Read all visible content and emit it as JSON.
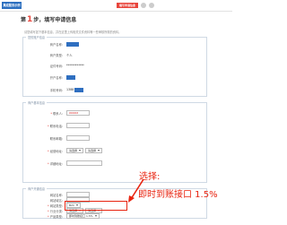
{
  "topbar": {
    "logo": "集成服务示例",
    "steps": [
      "填写申请信息",
      "",
      ""
    ],
    "active_step": 0
  },
  "header": {
    "step_prefix": "第",
    "step_number": "1",
    "title": "步，填写申请信息"
  },
  "intro": "请您填写如下基本信息，并在这里上传相关文件资料等一些审核所需的资料。",
  "section1": {
    "title": "您的账户信息",
    "rows": [
      {
        "label": "商户名称:",
        "value": ""
      },
      {
        "label": "商户类型:",
        "value": "个人"
      },
      {
        "label": "证件号码:",
        "value": "************"
      },
      {
        "label": "开户名称:",
        "value": ""
      },
      {
        "label": "手机号码:",
        "value": "1388"
      }
    ]
  },
  "section2": {
    "title": "商户基本信息",
    "rows": [
      {
        "label": "联系人:",
        "required": true,
        "value": "XXXXX"
      },
      {
        "label": "联系电话:",
        "required": true,
        "value": ""
      },
      {
        "label": "联系邮箱:",
        "required": false,
        "value": ""
      },
      {
        "label": "经营地址:",
        "required": true,
        "select1": "请选择",
        "select2": "请选择"
      },
      {
        "label": "详细地址:",
        "required": true,
        "value": ""
      }
    ]
  },
  "section3": {
    "title": "商户开通信息",
    "rows": [
      {
        "label": "网站名称:",
        "required": false,
        "value": ""
      },
      {
        "label": "网站域名:",
        "required": false,
        "value": ""
      },
      {
        "label": "网站类型:",
        "required": true,
        "select1": "B2C"
      },
      {
        "label": "行业分类:",
        "required": true,
        "select1": "请选择",
        "select2": "请选择"
      },
      {
        "label": "产品类型:",
        "required": true,
        "select1": "即时到账接口 1.5%"
      }
    ]
  },
  "annotation": {
    "line1": "选择:",
    "line2": "即时到账接口 1.5%",
    "color": "#e8230f"
  }
}
